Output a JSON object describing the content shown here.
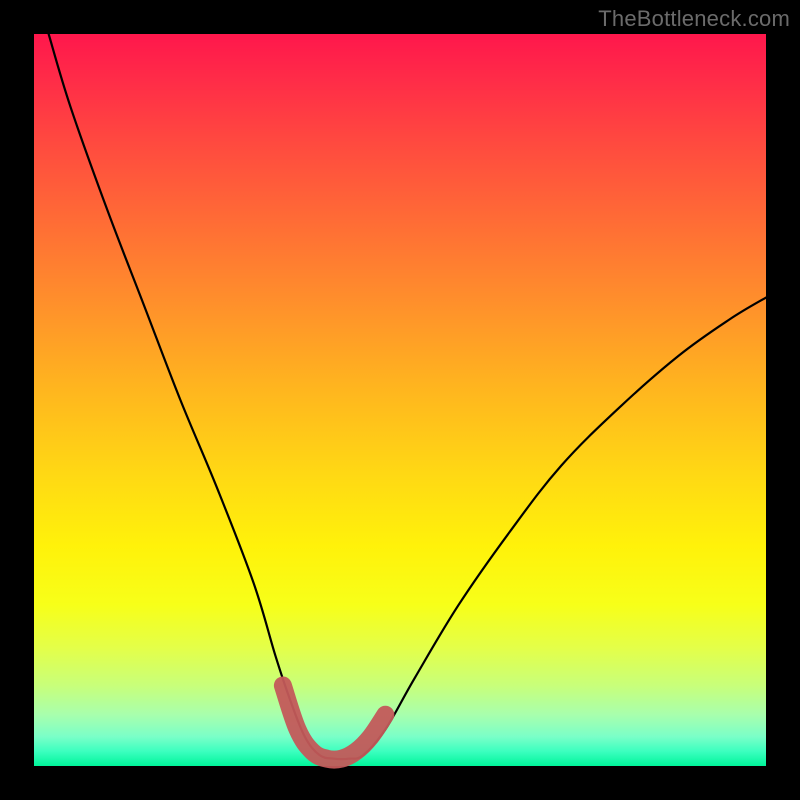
{
  "watermark": {
    "text": "TheBottleneck.com"
  },
  "chart_data": {
    "type": "line",
    "title": "",
    "xlabel": "",
    "ylabel": "",
    "xlim": [
      0,
      100
    ],
    "ylim": [
      0,
      100
    ],
    "grid": false,
    "series": [
      {
        "name": "bottleneck-curve",
        "x": [
          2,
          5,
          10,
          15,
          20,
          25,
          30,
          33,
          35,
          37,
          39,
          41,
          43,
          45,
          48,
          52,
          58,
          65,
          72,
          80,
          88,
          95,
          100
        ],
        "values": [
          100,
          90,
          76,
          63,
          50,
          38,
          25,
          15,
          9,
          4,
          1.5,
          1,
          1,
          1.5,
          5,
          12,
          22,
          32,
          41,
          49,
          56,
          61,
          64
        ]
      }
    ],
    "highlight": {
      "name": "flat-bottom-highlight",
      "x": [
        34,
        36,
        38,
        40,
        42,
        44,
        46,
        48
      ],
      "values": [
        11,
        5,
        2,
        1,
        1,
        2,
        4,
        7
      ]
    }
  }
}
